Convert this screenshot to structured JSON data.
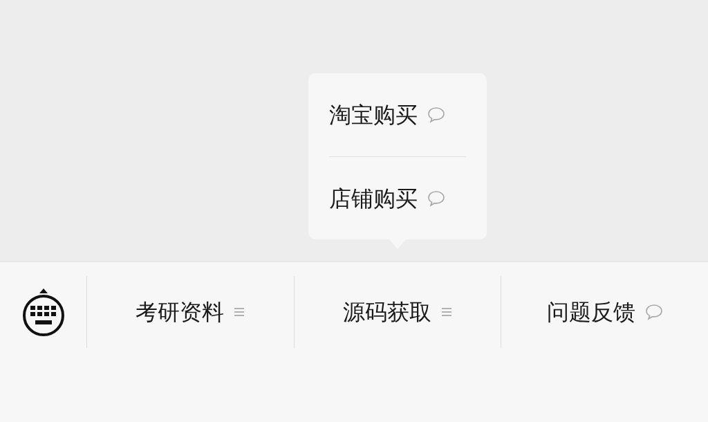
{
  "menu_bar": {
    "items": [
      {
        "label": "考研资料",
        "kind": "submenu"
      },
      {
        "label": "源码获取",
        "kind": "submenu",
        "popup_items": [
          {
            "label": "淘宝购买",
            "kind": "message"
          },
          {
            "label": "店铺购买",
            "kind": "message"
          }
        ]
      },
      {
        "label": "问题反馈",
        "kind": "message"
      }
    ]
  }
}
